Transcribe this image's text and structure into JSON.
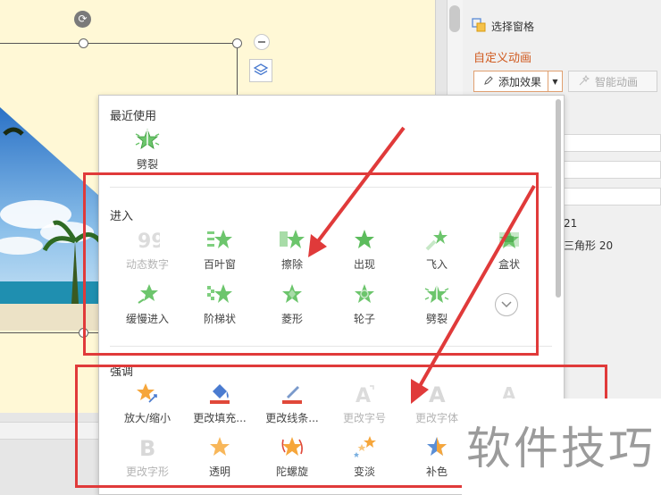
{
  "right_pane": {
    "selection_pane_label": "选择窗格",
    "custom_animation_title": "自定义动画",
    "add_effect_label": "添加效果",
    "smart_animation_label": "智能动画",
    "list_item_1": "21",
    "list_item_2": "三角形 20"
  },
  "gallery": {
    "recent": {
      "title": "最近使用",
      "items": [
        {
          "label": "劈裂",
          "icon": "split-star-icon",
          "enabled": true
        }
      ]
    },
    "entrance": {
      "title": "进入",
      "items": [
        {
          "label": "动态数字",
          "icon": "dynamic-number-icon",
          "enabled": false
        },
        {
          "label": "百叶窗",
          "icon": "blinds-star-icon",
          "enabled": true
        },
        {
          "label": "擦除",
          "icon": "wipe-star-icon",
          "enabled": true
        },
        {
          "label": "出现",
          "icon": "appear-star-icon",
          "enabled": true
        },
        {
          "label": "飞入",
          "icon": "fly-in-star-icon",
          "enabled": true
        },
        {
          "label": "盒状",
          "icon": "box-star-icon",
          "enabled": true
        },
        {
          "label": "缓慢进入",
          "icon": "crawl-in-star-icon",
          "enabled": true
        },
        {
          "label": "阶梯状",
          "icon": "checkerboard-star-icon",
          "enabled": true
        },
        {
          "label": "菱形",
          "icon": "diamond-star-icon",
          "enabled": true
        },
        {
          "label": "轮子",
          "icon": "wheel-star-icon",
          "enabled": true
        },
        {
          "label": "劈裂",
          "icon": "split-star-icon",
          "enabled": true
        }
      ]
    },
    "emphasis": {
      "title": "强调",
      "items": [
        {
          "label": "放大/缩小",
          "icon": "grow-shrink-star-icon",
          "enabled": true
        },
        {
          "label": "更改填充...",
          "icon": "change-fill-icon",
          "enabled": true
        },
        {
          "label": "更改线条...",
          "icon": "change-line-icon",
          "enabled": true
        },
        {
          "label": "更改字号",
          "icon": "change-font-size-icon",
          "enabled": false
        },
        {
          "label": "更改字体",
          "icon": "change-font-icon",
          "enabled": false
        },
        {
          "label": "",
          "icon": "font-icon",
          "enabled": false
        },
        {
          "label": "更改字形",
          "icon": "change-font-style-icon",
          "enabled": false
        },
        {
          "label": "透明",
          "icon": "transparency-star-icon",
          "enabled": true
        },
        {
          "label": "陀螺旋",
          "icon": "spin-star-icon",
          "enabled": true
        },
        {
          "label": "变淡",
          "icon": "fade-star-icon",
          "enabled": true
        },
        {
          "label": "补色",
          "icon": "complementary-color-star-icon",
          "enabled": true
        }
      ]
    }
  },
  "watermark": "软件技巧",
  "colors": {
    "accent_orange": "#d05a1f",
    "highlight_red": "#e03a3a",
    "entrance_green": "#6cc56c",
    "emphasis_orange": "#f6a63b",
    "slide_bg": "#fff8d6"
  }
}
